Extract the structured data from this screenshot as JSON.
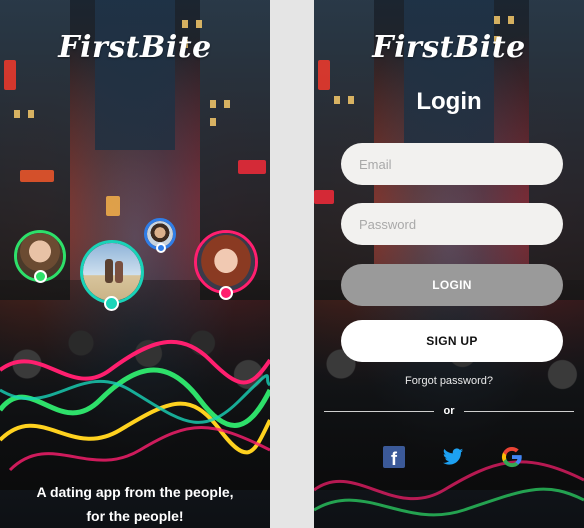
{
  "app": {
    "brand": "FirstBite"
  },
  "onboarding": {
    "tagline_line1": "A dating app from the people,",
    "tagline_line2": "for the people!",
    "avatars": [
      {
        "name": "avatar-woman-curly",
        "ring_color": "#2ee06a",
        "dot_color": "#2ee06a"
      },
      {
        "name": "avatar-couple-beach",
        "ring_color": "#19d3b8",
        "dot_color": "#19d3b8"
      },
      {
        "name": "avatar-man-small",
        "ring_color": "#2f7ee8",
        "dot_color": "#2f7ee8"
      },
      {
        "name": "avatar-woman-redhair",
        "ring_color": "#ff1f6f",
        "dot_color": "#ff1f6f"
      }
    ],
    "wave_colors": [
      "#ff1f6f",
      "#2ee06a",
      "#ffd21f",
      "#19d3b8"
    ]
  },
  "login": {
    "title": "Login",
    "email_placeholder": "Email",
    "password_placeholder": "Password",
    "login_label": "LOGIN",
    "signup_label": "SIGN UP",
    "forgot_label": "Forgot password?",
    "or_label": "or",
    "social": [
      {
        "name": "facebook-icon",
        "label": "f",
        "color": "#3b5998"
      },
      {
        "name": "twitter-icon",
        "color": "#1da1f2"
      },
      {
        "name": "google-icon"
      }
    ]
  },
  "colors": {
    "button_login": "#9a9a9a",
    "button_signup": "#ffffff",
    "field_bg": "#f2f1ef"
  }
}
